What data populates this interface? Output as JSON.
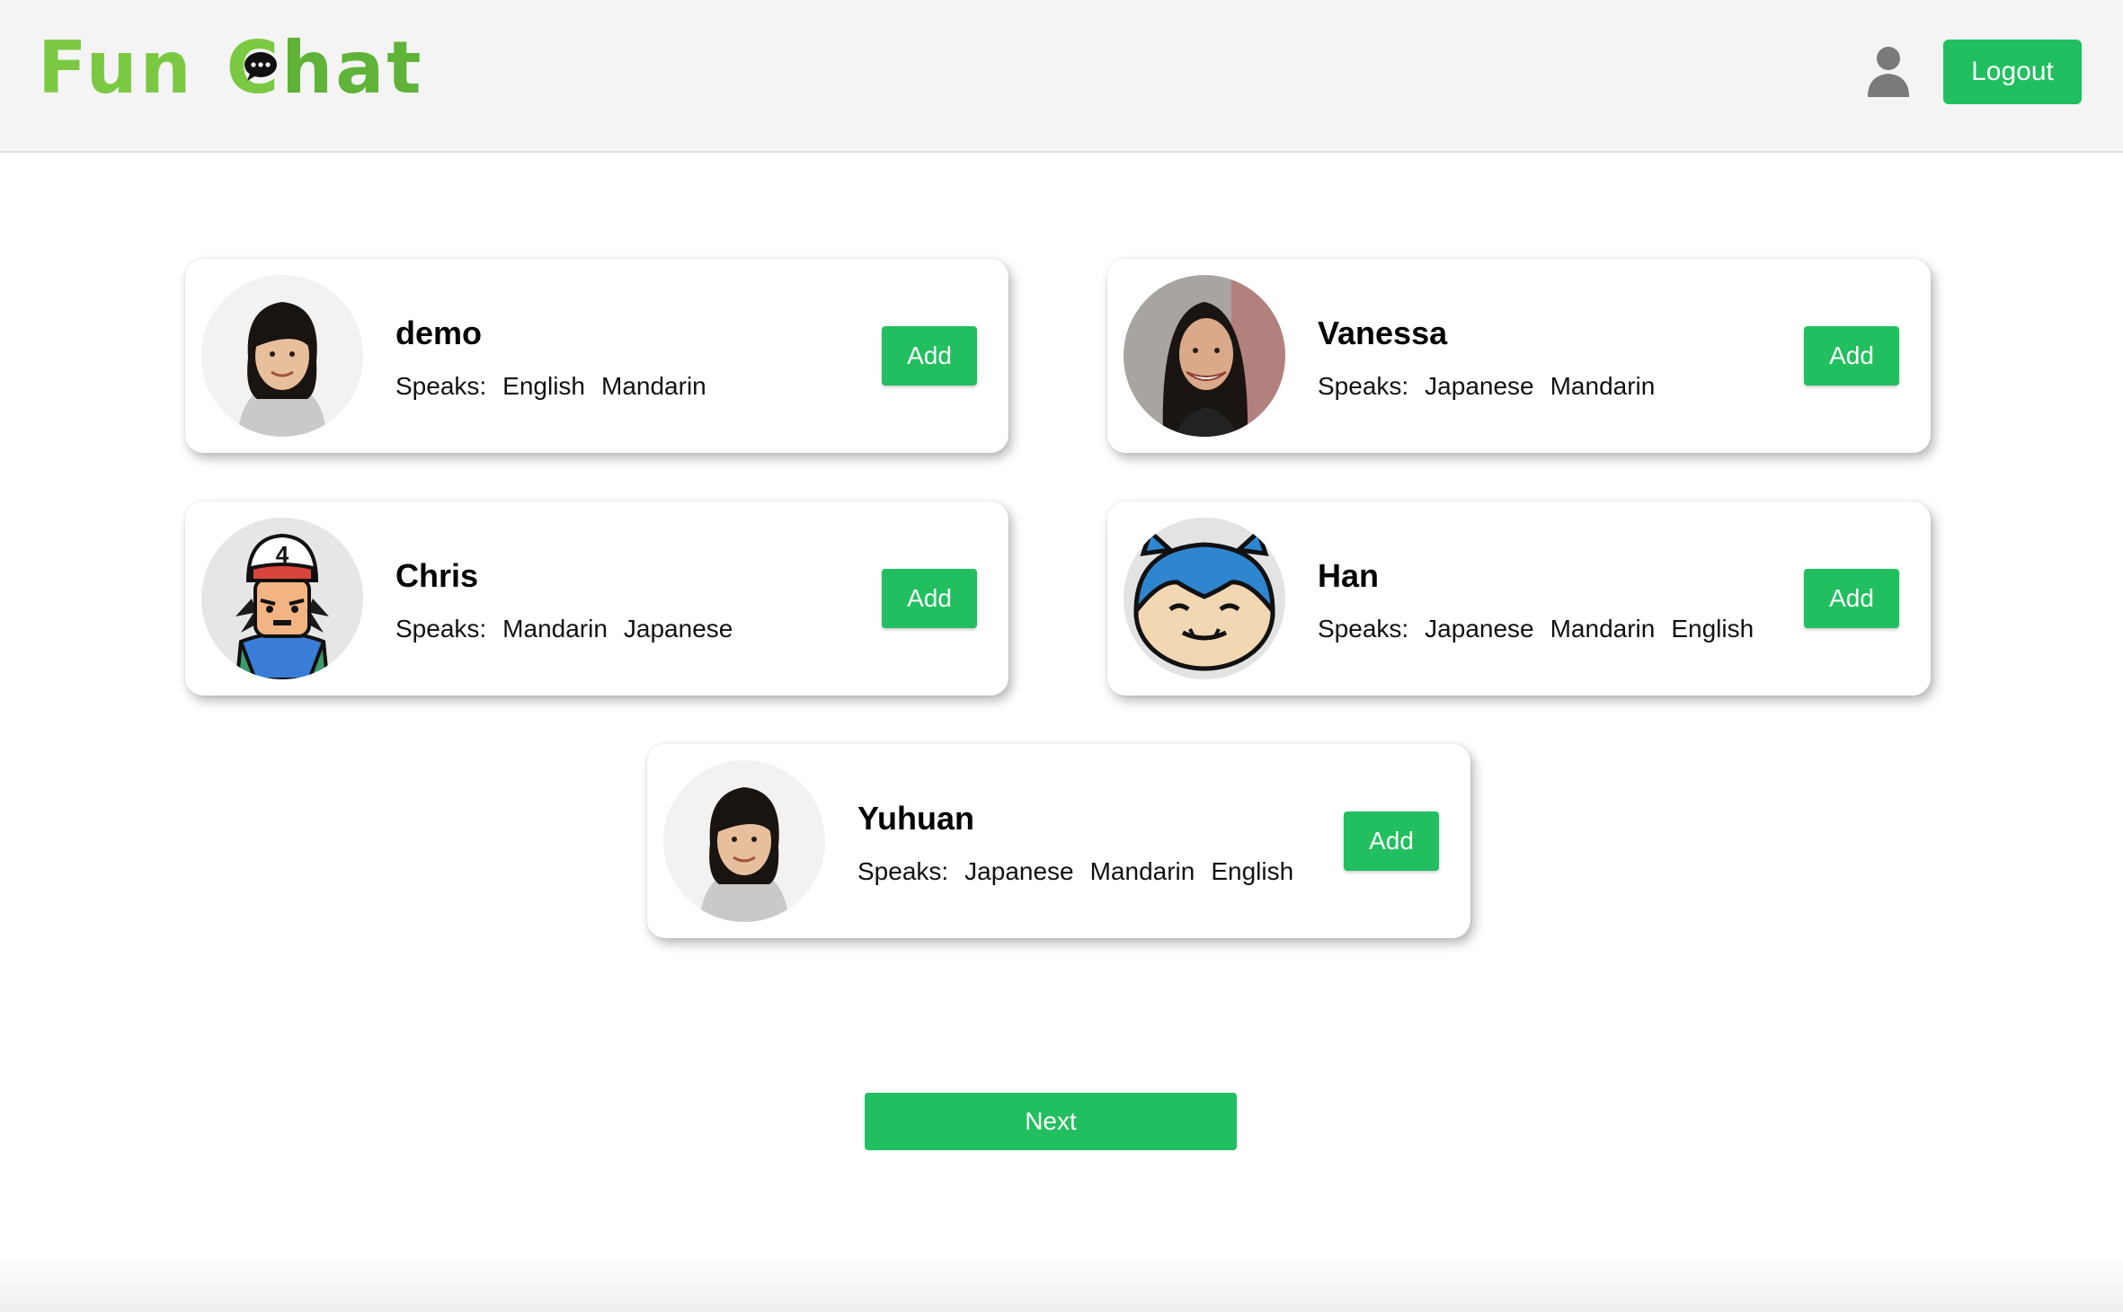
{
  "header": {
    "logo_part1": "Fun",
    "logo_c": "C",
    "logo_part2": "hat",
    "logout_label": "Logout",
    "user_icon": "user-icon"
  },
  "speaks_label": "Speaks:",
  "add_label": "Add",
  "users": [
    {
      "name": "demo",
      "languages": [
        "English",
        "Mandarin"
      ],
      "avatar": "woman-photo"
    },
    {
      "name": "Vanessa",
      "languages": [
        "Japanese",
        "Mandarin"
      ],
      "avatar": "woman-smiling-photo"
    },
    {
      "name": "Chris",
      "languages": [
        "Mandarin",
        "Japanese"
      ],
      "avatar": "cartoon-trainer"
    },
    {
      "name": "Han",
      "languages": [
        "Japanese",
        "Mandarin",
        "English"
      ],
      "avatar": "cartoon-blue-creature"
    },
    {
      "name": "Yuhuan",
      "languages": [
        "Japanese",
        "Mandarin",
        "English"
      ],
      "avatar": "woman-photo"
    }
  ],
  "next_label": "Next",
  "colors": {
    "accent": "#21bf5f",
    "logo_green": "#7bc943",
    "header_bg": "#f4f4f4"
  }
}
